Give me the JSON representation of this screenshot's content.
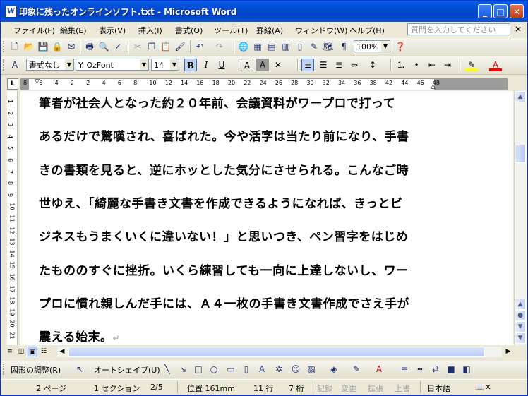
{
  "window": {
    "title": "印象に残ったオンラインソフト.txt - Microsoft Word",
    "app_icon": "W",
    "minimize_glyph": "_",
    "maximize_glyph": "□",
    "close_glyph": "✕"
  },
  "menubar": {
    "items": [
      "ファイル(F)",
      "編集(E)",
      "表示(V)",
      "挿入(I)",
      "書式(O)",
      "ツール(T)",
      "罫線(A)",
      "ウィンドウ(W)",
      "ヘルプ(H)"
    ],
    "help_placeholder": "質問を入力してください",
    "close_doc_glyph": "×"
  },
  "formatting": {
    "style": "書式なし",
    "font": "Y. OzFont",
    "size": "14",
    "zoom": "100%"
  },
  "ruler": {
    "numbers": [
      "8",
      "6",
      "4",
      "2",
      "2",
      "4",
      "6",
      "8",
      "10",
      "12",
      "14",
      "16",
      "18",
      "20",
      "22",
      "24",
      "26",
      "28",
      "30",
      "32",
      "34",
      "36",
      "38",
      "42",
      "44",
      "46",
      "48"
    ],
    "vertical_numbers": [
      "1",
      "2",
      "3",
      "4",
      "5",
      "6",
      "7",
      "8",
      "9",
      "10",
      "11",
      "12",
      "13",
      "14",
      "15",
      "16",
      "17",
      "18",
      "19",
      "20",
      "21"
    ]
  },
  "document": {
    "lines": [
      "筆者が社会人となった約２０年前、会議資料がワープロで打って",
      "あるだけで驚嘆され、喜ばれた。今や活字は当たり前になり、手書",
      "きの書類を見ると、逆にホッとした気分にさせられる。こんなご時",
      "世ゆえ、「綺麗な手書き文書を作成できるようになれば、きっとビ",
      "ジネスもうまくいくに違いない！」と思いつき、ペン習字をはじめ",
      "たもののすぐに挫折。いくら練習しても一向に上達しないし、ワー",
      "プロに慣れ親しんだ手には、Ａ４一枚の手書き文書作成でさえ手が",
      "震える始末。"
    ],
    "paragraph_mark": "↵"
  },
  "drawing_toolbar": {
    "adjust_label": "図形の調整(R)",
    "autoshape_label": "オートシェイプ(U)"
  },
  "statusbar": {
    "page": "2 ページ",
    "section": "1 セクション",
    "page_of": "2/5",
    "position": "位置 161mm",
    "line": "11 行",
    "column": "7 桁",
    "rec": "記録",
    "trk": "変更",
    "ext": "拡張",
    "ovr": "上書",
    "language": "日本語"
  }
}
